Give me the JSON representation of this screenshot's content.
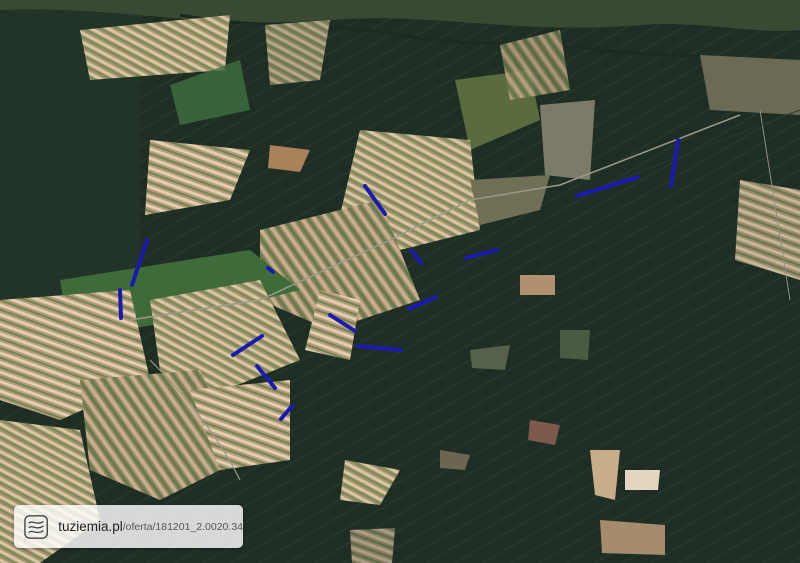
{
  "map": {
    "type": "satellite",
    "highlight_color": "#1a1ab0",
    "forest_color": "#1f2e25",
    "field_colors": [
      "#c9b28f",
      "#8f9a63",
      "#b08a6a",
      "#6f8a50",
      "#d8c9a8"
    ]
  },
  "watermark": {
    "logo_icon": "tuziemia-logo-icon",
    "brand": "tuziemia.pl",
    "path": "/oferta/181201_2.0020.34"
  }
}
